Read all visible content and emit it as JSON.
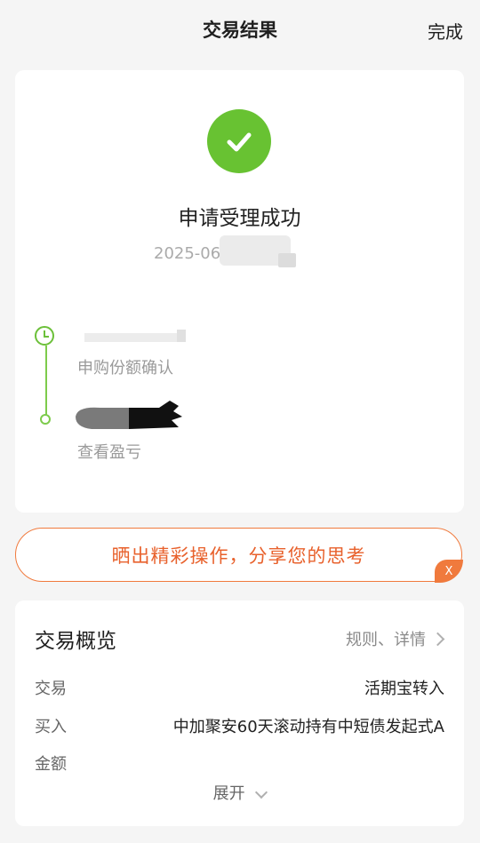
{
  "topbar": {
    "title": "交易结果",
    "done_label": "完成"
  },
  "result": {
    "icon": "check-circle-icon",
    "title": "申请受理成功",
    "time_text": "2025-06",
    "steps": [
      {
        "icon": "clock-icon",
        "label": "申购份额确认"
      },
      {
        "icon": "timeline-dot-icon",
        "label": "查看盈亏"
      }
    ]
  },
  "share": {
    "text": "晒出精彩操作，分享您的思考",
    "close_label": "X"
  },
  "overview": {
    "title": "交易概览",
    "rules_label": "规则、详情",
    "rows": [
      {
        "key": "交易",
        "value": "活期宝转入"
      },
      {
        "key": "买入",
        "value": "中加聚安60天滚动持有中短债发起式A"
      },
      {
        "key": "金额",
        "value": ""
      }
    ],
    "expand_label": "展开"
  },
  "colors": {
    "success_green": "#68c232",
    "accent_orange": "#e8612c",
    "page_bg": "#f5f5f5"
  }
}
